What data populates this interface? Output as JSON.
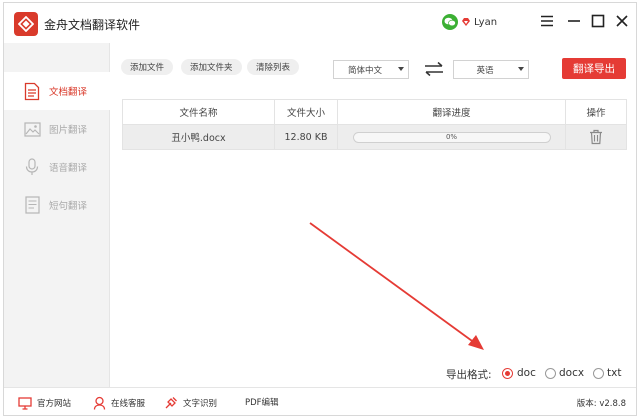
{
  "app": {
    "title": "金舟文档翻译软件",
    "logo_icon": "app-logo-icon"
  },
  "user": {
    "name": "Lyan"
  },
  "window_controls": [
    "menu-icon",
    "minimize-icon",
    "maximize-icon",
    "close-icon"
  ],
  "sidebar": {
    "items": [
      {
        "label": "文档翻译",
        "icon": "document-icon",
        "active": true
      },
      {
        "label": "图片翻译",
        "icon": "image-icon",
        "active": false
      },
      {
        "label": "语音翻译",
        "icon": "microphone-icon",
        "active": false
      },
      {
        "label": "短句翻译",
        "icon": "text-icon",
        "active": false
      }
    ]
  },
  "toolbar": {
    "add_file": "添加文件",
    "add_folder": "添加文件夹",
    "clear_list": "清除列表",
    "source_lang": "简体中文",
    "target_lang": "英语",
    "export_label": "翻译导出"
  },
  "table": {
    "headers": [
      "文件名称",
      "文件大小",
      "翻译进度",
      "操作"
    ],
    "rows": [
      {
        "file_name": "丑小鸭.docx",
        "file_size": "12.80 KB",
        "progress_text": "0%",
        "progress": 0
      }
    ]
  },
  "export_format": {
    "label": "导出格式:",
    "options": [
      "doc",
      "docx",
      "txt"
    ],
    "selected": "doc"
  },
  "footer": {
    "official_site": "官方网站",
    "online_support": "在线客服",
    "ocr": "文字识别",
    "pdf_edit": "PDF编辑",
    "version": "版本: v2.8.8"
  },
  "colors": {
    "accent": "#e53b35",
    "logo": "#d93a2b",
    "wechat": "#3cb034"
  }
}
